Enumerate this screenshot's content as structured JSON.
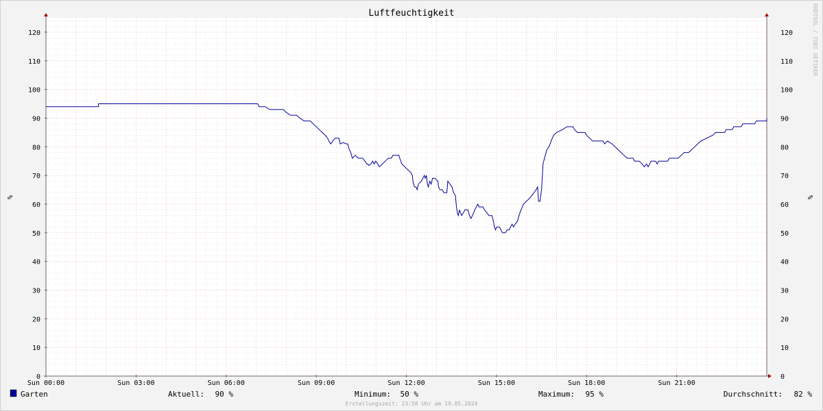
{
  "chart_data": {
    "type": "line",
    "title": "Luftfeuchtigkeit",
    "ylabel": "%",
    "ylim": [
      0,
      125
    ],
    "yticks": [
      0,
      10,
      20,
      30,
      40,
      50,
      60,
      70,
      80,
      90,
      100,
      110,
      120
    ],
    "xlim": [
      0,
      24
    ],
    "xticks": [
      {
        "hour": 0,
        "label": "Sun 00:00"
      },
      {
        "hour": 3,
        "label": "Sun 03:00"
      },
      {
        "hour": 6,
        "label": "Sun 06:00"
      },
      {
        "hour": 9,
        "label": "Sun 09:00"
      },
      {
        "hour": 12,
        "label": "Sun 12:00"
      },
      {
        "hour": 15,
        "label": "Sun 15:00"
      },
      {
        "hour": 18,
        "label": "Sun 18:00"
      },
      {
        "hour": 21,
        "label": "Sun 21:00"
      }
    ],
    "grid": true,
    "series": [
      {
        "name": "Garten",
        "color": "#000099",
        "points": [
          [
            0,
            94
          ],
          [
            1.75,
            94
          ],
          [
            1.75,
            95
          ],
          [
            7.05,
            95
          ],
          [
            7.1,
            94
          ],
          [
            7.3,
            94
          ],
          [
            7.45,
            93
          ],
          [
            7.9,
            93
          ],
          [
            8.0,
            92
          ],
          [
            8.15,
            91
          ],
          [
            8.35,
            91
          ],
          [
            8.45,
            90
          ],
          [
            8.6,
            89
          ],
          [
            8.8,
            89
          ],
          [
            8.9,
            88
          ],
          [
            9.0,
            87
          ],
          [
            9.1,
            86
          ],
          [
            9.2,
            85
          ],
          [
            9.3,
            84
          ],
          [
            9.38,
            83
          ],
          [
            9.42,
            82
          ],
          [
            9.48,
            81
          ],
          [
            9.55,
            82
          ],
          [
            9.62,
            83
          ],
          [
            9.75,
            83
          ],
          [
            9.8,
            81
          ],
          [
            9.9,
            81.5
          ],
          [
            10.0,
            81
          ],
          [
            10.05,
            81
          ],
          [
            10.1,
            79
          ],
          [
            10.15,
            78
          ],
          [
            10.2,
            76
          ],
          [
            10.3,
            77
          ],
          [
            10.4,
            76
          ],
          [
            10.55,
            76
          ],
          [
            10.62,
            75
          ],
          [
            10.68,
            74
          ],
          [
            10.72,
            74
          ],
          [
            10.75,
            73.5
          ],
          [
            10.82,
            74
          ],
          [
            10.88,
            75
          ],
          [
            10.93,
            74
          ],
          [
            10.98,
            75
          ],
          [
            11.05,
            74
          ],
          [
            11.1,
            73
          ],
          [
            11.2,
            74
          ],
          [
            11.3,
            75
          ],
          [
            11.4,
            76
          ],
          [
            11.5,
            76
          ],
          [
            11.55,
            77
          ],
          [
            11.75,
            77
          ],
          [
            11.78,
            76
          ],
          [
            11.85,
            74
          ],
          [
            11.95,
            73
          ],
          [
            12.05,
            72
          ],
          [
            12.15,
            71
          ],
          [
            12.2,
            70
          ],
          [
            12.22,
            68
          ],
          [
            12.27,
            66
          ],
          [
            12.32,
            66
          ],
          [
            12.36,
            65
          ],
          [
            12.4,
            67
          ],
          [
            12.5,
            68
          ],
          [
            12.55,
            69
          ],
          [
            12.6,
            70
          ],
          [
            12.63,
            69
          ],
          [
            12.67,
            70
          ],
          [
            12.7,
            67
          ],
          [
            12.73,
            66
          ],
          [
            12.78,
            68
          ],
          [
            12.83,
            67
          ],
          [
            12.87,
            69
          ],
          [
            12.95,
            69
          ],
          [
            13.05,
            68
          ],
          [
            13.07,
            66
          ],
          [
            13.12,
            65
          ],
          [
            13.2,
            65
          ],
          [
            13.25,
            64
          ],
          [
            13.35,
            64
          ],
          [
            13.38,
            68
          ],
          [
            13.45,
            67
          ],
          [
            13.52,
            66
          ],
          [
            13.57,
            64
          ],
          [
            13.63,
            63
          ],
          [
            13.67,
            59
          ],
          [
            13.7,
            57
          ],
          [
            13.73,
            56
          ],
          [
            13.77,
            58
          ],
          [
            13.8,
            57
          ],
          [
            13.84,
            56
          ],
          [
            13.9,
            57
          ],
          [
            13.95,
            58
          ],
          [
            14.05,
            58
          ],
          [
            14.1,
            56
          ],
          [
            14.15,
            55
          ],
          [
            14.2,
            56
          ],
          [
            14.28,
            58
          ],
          [
            14.33,
            59
          ],
          [
            14.38,
            60
          ],
          [
            14.42,
            59
          ],
          [
            14.55,
            59
          ],
          [
            14.6,
            58
          ],
          [
            14.68,
            57
          ],
          [
            14.75,
            56
          ],
          [
            14.85,
            56
          ],
          [
            14.9,
            54
          ],
          [
            14.93,
            52
          ],
          [
            14.97,
            51
          ],
          [
            15.0,
            52
          ],
          [
            15.1,
            52
          ],
          [
            15.15,
            51
          ],
          [
            15.2,
            50
          ],
          [
            15.3,
            50
          ],
          [
            15.35,
            51
          ],
          [
            15.42,
            51
          ],
          [
            15.47,
            52
          ],
          [
            15.52,
            53
          ],
          [
            15.57,
            52
          ],
          [
            15.62,
            53
          ],
          [
            15.7,
            54
          ],
          [
            15.75,
            56
          ],
          [
            15.82,
            58
          ],
          [
            15.9,
            60
          ],
          [
            16.0,
            61
          ],
          [
            16.1,
            62
          ],
          [
            16.18,
            63
          ],
          [
            16.25,
            64
          ],
          [
            16.32,
            65
          ],
          [
            16.37,
            66
          ],
          [
            16.4,
            61
          ],
          [
            16.45,
            61
          ],
          [
            16.5,
            65
          ],
          [
            16.55,
            74
          ],
          [
            16.6,
            76
          ],
          [
            16.68,
            79
          ],
          [
            16.75,
            80
          ],
          [
            16.82,
            82
          ],
          [
            16.9,
            84
          ],
          [
            17.0,
            85
          ],
          [
            17.1,
            85.5
          ],
          [
            17.2,
            86
          ],
          [
            17.35,
            87
          ],
          [
            17.55,
            87
          ],
          [
            17.6,
            86
          ],
          [
            17.7,
            85
          ],
          [
            17.95,
            85
          ],
          [
            18.0,
            84
          ],
          [
            18.1,
            83
          ],
          [
            18.2,
            82
          ],
          [
            18.55,
            82
          ],
          [
            18.6,
            81
          ],
          [
            18.7,
            82
          ],
          [
            18.85,
            81
          ],
          [
            18.95,
            80
          ],
          [
            19.05,
            79
          ],
          [
            19.15,
            78
          ],
          [
            19.25,
            77
          ],
          [
            19.35,
            76
          ],
          [
            19.55,
            76
          ],
          [
            19.6,
            75
          ],
          [
            19.75,
            75
          ],
          [
            19.85,
            74
          ],
          [
            19.92,
            73
          ],
          [
            20.0,
            74
          ],
          [
            20.05,
            73
          ],
          [
            20.15,
            75
          ],
          [
            20.3,
            75
          ],
          [
            20.35,
            74
          ],
          [
            20.4,
            75
          ],
          [
            20.7,
            75
          ],
          [
            20.75,
            76
          ],
          [
            21.05,
            76
          ],
          [
            21.15,
            77
          ],
          [
            21.25,
            78
          ],
          [
            21.4,
            78
          ],
          [
            21.5,
            79
          ],
          [
            21.6,
            80
          ],
          [
            21.7,
            81
          ],
          [
            21.8,
            82
          ],
          [
            22.0,
            83
          ],
          [
            22.2,
            84
          ],
          [
            22.3,
            85
          ],
          [
            22.6,
            85
          ],
          [
            22.65,
            86
          ],
          [
            22.85,
            86
          ],
          [
            22.9,
            87
          ],
          [
            23.15,
            87
          ],
          [
            23.2,
            88
          ],
          [
            23.6,
            88
          ],
          [
            23.65,
            89
          ],
          [
            24.25,
            89
          ],
          [
            24.3,
            90
          ],
          [
            25.1,
            90
          ]
        ]
      }
    ]
  },
  "legend": {
    "series_label": "Garten",
    "series_color": "#000099",
    "stats": [
      {
        "label": "Aktuell:",
        "value": "90 %"
      },
      {
        "label": "Minimum:",
        "value": "50 %"
      },
      {
        "label": "Maximum:",
        "value": "95 %"
      },
      {
        "label": "Durchschnitt:",
        "value": "82 %"
      }
    ]
  },
  "watermark": "RRDTOOL / TOBI OETIKER",
  "footer": "Erstellungszeit: 23:58 Uhr am 19.05.2024"
}
